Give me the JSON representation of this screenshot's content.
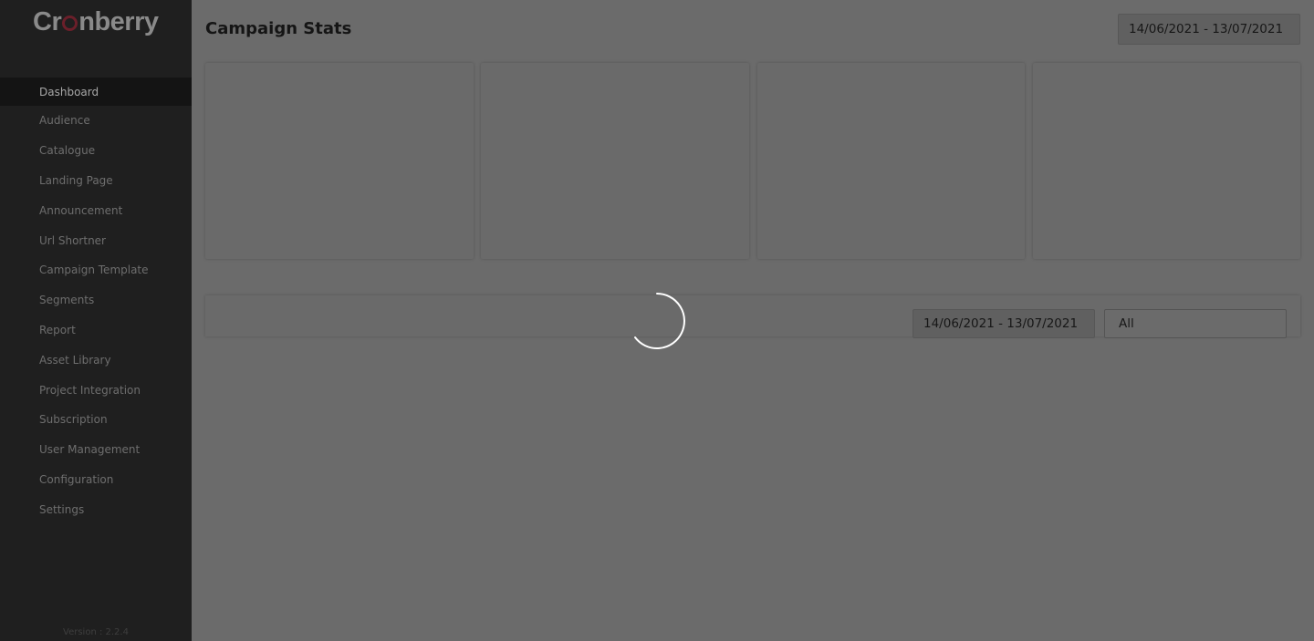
{
  "app": {
    "logo_text_pre": "Cr",
    "logo_text_post": "nberry",
    "version": "Version : 2.2.4"
  },
  "sidebar": {
    "items": [
      {
        "label": "Dashboard",
        "active": true
      },
      {
        "label": "Audience"
      },
      {
        "label": "Catalogue"
      },
      {
        "label": "Landing Page"
      },
      {
        "label": "Announcement"
      },
      {
        "label": "Url Shortner"
      },
      {
        "label": "Campaign Template"
      },
      {
        "label": "Segments"
      },
      {
        "label": "Report"
      },
      {
        "label": "Asset Library"
      },
      {
        "label": "Project Integration"
      },
      {
        "label": "Subscription"
      },
      {
        "label": "User Management"
      },
      {
        "label": "Configuration"
      },
      {
        "label": "Settings"
      }
    ]
  },
  "main": {
    "title": "Campaign Stats",
    "date_range": "14/06/2021 - 13/07/2021",
    "panel": {
      "date_range": "14/06/2021 - 13/07/2021",
      "filter_value": "All"
    }
  },
  "colors": {
    "brand_accent": "#6b1f2a",
    "overlay": "#6b6b6b",
    "sidebar_bg": "#1f1f1f"
  }
}
